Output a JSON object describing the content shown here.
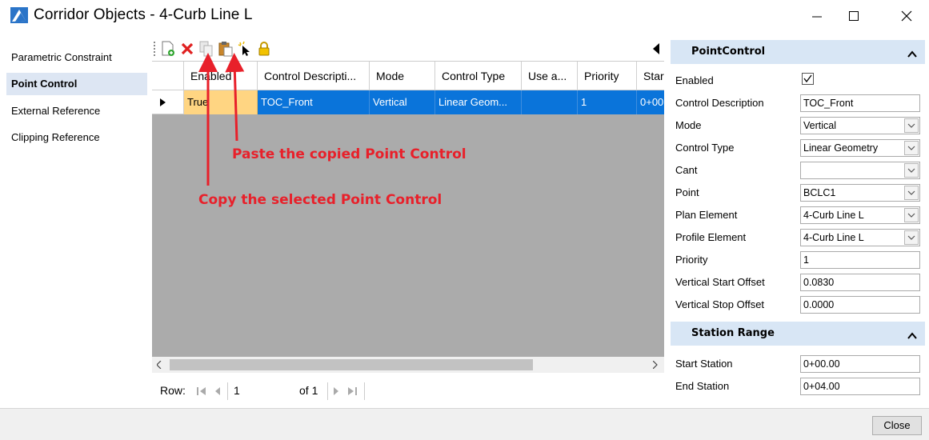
{
  "window": {
    "title": "Corridor Objects - 4-Curb Line L",
    "minimize_symbol": "—",
    "maximize_symbol": "☐",
    "close_symbol": "✕"
  },
  "nav": {
    "items": [
      {
        "label": "Parametric Constraint",
        "selected": false
      },
      {
        "label": "Point Control",
        "selected": true
      },
      {
        "label": "External Reference",
        "selected": false
      },
      {
        "label": "Clipping Reference",
        "selected": false
      }
    ]
  },
  "toolbar": {
    "icons": [
      "add-document-icon",
      "delete-icon",
      "copy-icon",
      "paste-icon",
      "select-icon",
      "lock-icon"
    ]
  },
  "grid": {
    "columns": [
      "Enabled",
      "Control Descripti...",
      "Mode",
      "Control Type",
      "Use a...",
      "Priority",
      "Star"
    ],
    "rows": [
      [
        "True",
        "TOC_Front",
        "Vertical",
        "Linear Geom...",
        "",
        "1",
        "0+00"
      ]
    ]
  },
  "navbar": {
    "row_label": "Row:",
    "row_value": "1",
    "of_text": "of 1"
  },
  "properties": {
    "section1_title": "PointControl",
    "enabled_label": "Enabled",
    "enabled_checked": true,
    "control_description_label": "Control Description",
    "control_description_value": "TOC_Front",
    "mode_label": "Mode",
    "mode_value": "Vertical",
    "control_type_label": "Control Type",
    "control_type_value": "Linear Geometry",
    "cant_label": "Cant",
    "cant_value": "",
    "point_label": "Point",
    "point_value": "BCLC1",
    "plan_element_label": "Plan Element",
    "plan_element_value": "4-Curb Line L",
    "profile_element_label": "Profile Element",
    "profile_element_value": "4-Curb Line L",
    "priority_label": "Priority",
    "priority_value": "1",
    "vertical_start_offset_label": "Vertical Start Offset",
    "vertical_start_offset_value": "0.0830",
    "vertical_stop_offset_label": "Vertical Stop Offset",
    "vertical_stop_offset_value": "0.0000",
    "section2_title": "Station Range",
    "start_station_label": "Start Station",
    "start_station_value": "0+00.00",
    "end_station_label": "End Station",
    "end_station_value": "0+04.00"
  },
  "footer": {
    "close_label": "Close"
  },
  "annotations": {
    "paste": "Paste the copied Point Control",
    "copy": "Copy the selected Point Control"
  },
  "colors": {
    "selection_blue": "#0a74da",
    "nav_selected": "#dde6f3",
    "section_header": "#d8e6f5",
    "annotation_red": "#e8202a",
    "grid_empty": "#ababab"
  }
}
